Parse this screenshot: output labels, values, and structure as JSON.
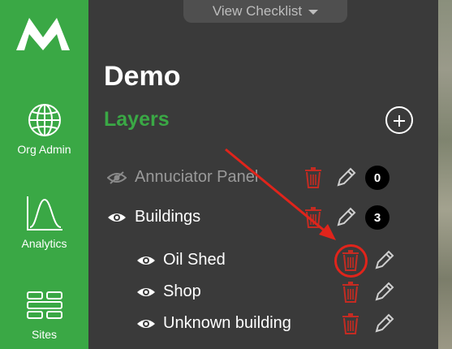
{
  "sidebar": {
    "logo": "m-logo-icon",
    "items": [
      {
        "label": "Org Admin",
        "icon": "globe-icon"
      },
      {
        "label": "Analytics",
        "icon": "chart-curve-icon"
      },
      {
        "label": "Sites",
        "icon": "sites-grid-icon"
      }
    ]
  },
  "header": {
    "checklist_button": "View Checklist"
  },
  "project": {
    "title": "Demo"
  },
  "layers": {
    "heading": "Layers",
    "items": [
      {
        "name": "Annuciator Panel",
        "visible": false,
        "count": "0"
      },
      {
        "name": "Buildings",
        "visible": true,
        "count": "3"
      },
      {
        "name": "Oil Shed",
        "visible": true
      },
      {
        "name": "Shop",
        "visible": true
      },
      {
        "name": "Unknown building",
        "visible": true
      }
    ]
  },
  "colors": {
    "sidebar": "#3aa845",
    "panel": "#3a3a3a",
    "accent_green": "#3aa845",
    "delete_red": "#c42b22",
    "annotation_red": "#e0241b"
  }
}
